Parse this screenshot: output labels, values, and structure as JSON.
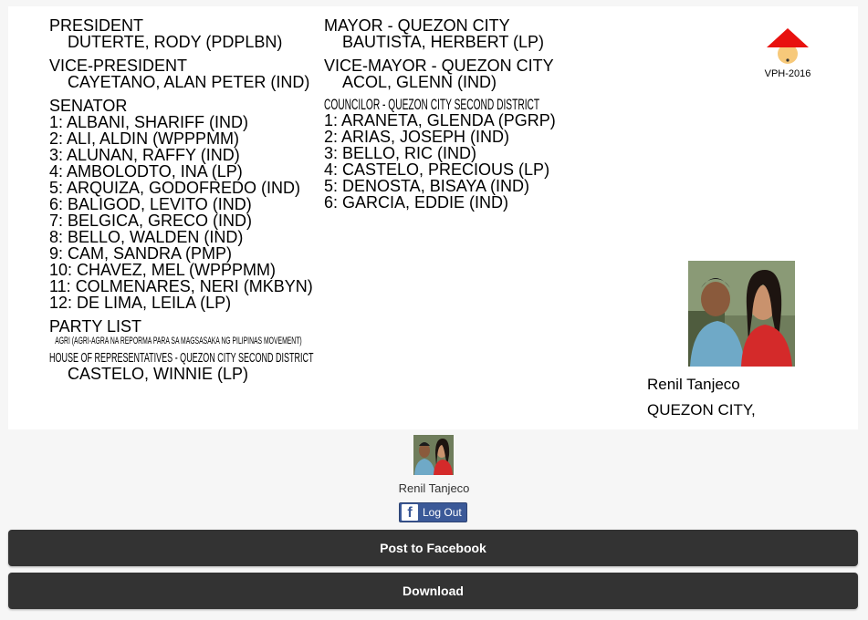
{
  "ballot": {
    "president": {
      "position": "PRESIDENT",
      "candidate": "DUTERTE, RODY (PDPLBN)"
    },
    "vice_president": {
      "position": "VICE-PRESIDENT",
      "candidate": "CAYETANO, ALAN PETER (IND)"
    },
    "senator": {
      "position": "SENATOR",
      "candidates": [
        "1: ALBANI, SHARIFF (IND)",
        "2: ALI, ALDIN (WPPPMM)",
        "3: ALUNAN, RAFFY (IND)",
        "4: AMBOLODTO, INA (LP)",
        "5: ARQUIZA, GODOFREDO (IND)",
        "6: BALIGOD, LEVITO (IND)",
        "7: BELGICA, GRECO (IND)",
        "8: BELLO, WALDEN (IND)",
        "9: CAM, SANDRA (PMP)",
        "10: CHAVEZ, MEL (WPPPMM)",
        "11: COLMENARES, NERI (MKBYN)",
        "12: DE LIMA, LEILA (LP)"
      ]
    },
    "party_list": {
      "position": "PARTY LIST",
      "candidate": "AGRI (AGRI-AGRA NA REPORMA PARA SA MAGSASAKA NG PILIPINAS MOVEMENT)"
    },
    "house_rep": {
      "position": "HOUSE OF REPRESENTATIVES - QUEZON CITY SECOND DISTRICT",
      "candidate": "CASTELO, WINNIE (LP)"
    },
    "mayor": {
      "position": "MAYOR - QUEZON CITY",
      "candidate": "BAUTISTA, HERBERT (LP)"
    },
    "vice_mayor": {
      "position": "VICE-MAYOR - QUEZON CITY",
      "candidate": "ACOL, GLENN (IND)"
    },
    "councilor": {
      "position": "COUNCILOR - QUEZON CITY SECOND DISTRICT",
      "candidates": [
        "1: ARANETA, GLENDA (PGRP)",
        "2: ARIAS, JOSEPH (IND)",
        "3: BELLO, RIC (IND)",
        "4: CASTELO, PRECIOUS (LP)",
        "5: DENOSTA, BISAYA (IND)",
        "6: GARCIA, EDDIE (IND)"
      ]
    },
    "logo_text": "VPH-2016",
    "voter_name": "Renil Tanjeco",
    "voter_city": "QUEZON CITY,"
  },
  "footer": {
    "user_name": "Renil Tanjeco",
    "logout_label": "Log Out",
    "post_label": "Post to Facebook",
    "download_label": "Download"
  },
  "colors": {
    "button_bg": "#333333",
    "facebook_blue": "#3b5998",
    "logo_red": "#e8110f",
    "logo_face": "#f7c97a",
    "page_bg": "#f6f6f6"
  },
  "icons": {
    "logo": "salakot-hat-icon",
    "facebook": "facebook-icon"
  }
}
